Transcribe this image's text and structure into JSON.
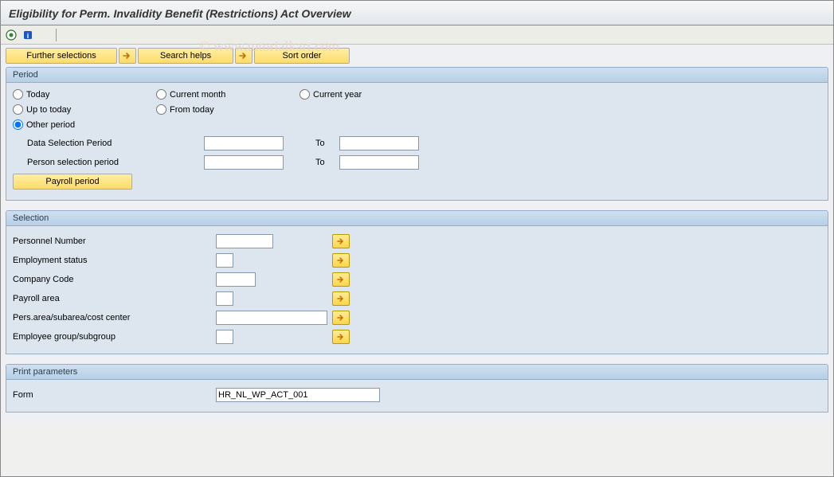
{
  "title": "Eligibility for Perm. Invalidity Benefit (Restrictions) Act Overview",
  "watermark": "© www.tutorialkart.com",
  "buttons": {
    "further_selections": "Further selections",
    "search_helps": "Search helps",
    "sort_order": "Sort order"
  },
  "period": {
    "header": "Period",
    "radios": {
      "today": "Today",
      "current_month": "Current month",
      "current_year": "Current year",
      "up_to_today": "Up to today",
      "from_today": "From today",
      "other_period": "Other period"
    },
    "labels": {
      "data_selection": "Data Selection Period",
      "person_selection": "Person selection period",
      "to": "To",
      "payroll_period": "Payroll period"
    },
    "values": {
      "data_from": "",
      "data_to": "",
      "person_from": "",
      "person_to": ""
    }
  },
  "selection": {
    "header": "Selection",
    "rows": {
      "personnel_number": {
        "label": "Personnel Number",
        "value": ""
      },
      "employment_status": {
        "label": "Employment status",
        "value": ""
      },
      "company_code": {
        "label": "Company Code",
        "value": ""
      },
      "payroll_area": {
        "label": "Payroll area",
        "value": ""
      },
      "pers_area": {
        "label": "Pers.area/subarea/cost center",
        "value": ""
      },
      "employee_group": {
        "label": "Employee group/subgroup",
        "value": ""
      }
    }
  },
  "print": {
    "header": "Print parameters",
    "form_label": "Form",
    "form_value": "HR_NL_WP_ACT_001"
  }
}
